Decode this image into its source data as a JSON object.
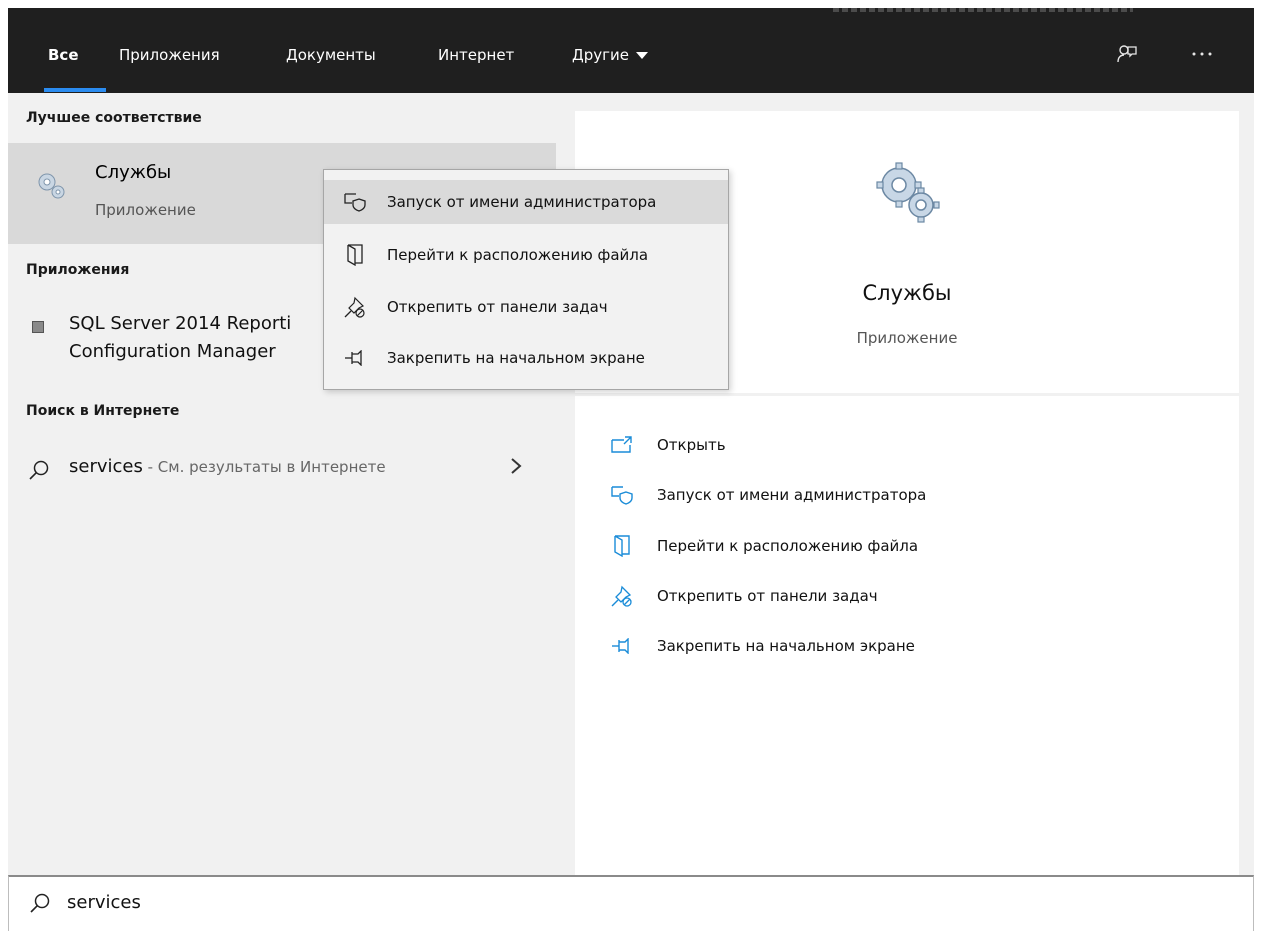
{
  "tabs": [
    {
      "label": "Все",
      "active": true
    },
    {
      "label": "Приложения"
    },
    {
      "label": "Документы"
    },
    {
      "label": "Интернет"
    },
    {
      "label": "Другие"
    }
  ],
  "topbar_icons": [
    "feedback-icon",
    "more-options-icon"
  ],
  "left": {
    "best_match_heading": "Лучшее соответствие",
    "best_match": {
      "title": "Службы",
      "subtitle": "Приложение",
      "icon": "services-gear-icon"
    },
    "apps_heading": "Приложения",
    "app_item": {
      "line1": "SQL Server 2014 Reporti",
      "line2": "Configuration Manager"
    },
    "web_heading": "Поиск в Интернете",
    "web_item": {
      "query": "services",
      "hint": " - См. результаты в Интернете"
    }
  },
  "context_menu": [
    {
      "label": "Запуск от имени администратора",
      "icon": "run-as-admin-icon"
    },
    {
      "label": "Перейти к расположению файла",
      "icon": "open-file-location-icon"
    },
    {
      "label": "Открепить от панели задач",
      "icon": "unpin-taskbar-icon"
    },
    {
      "label": "Закрепить на начальном экране",
      "icon": "pin-start-icon"
    }
  ],
  "preview": {
    "title": "Службы",
    "subtitle": "Приложение",
    "actions": [
      {
        "label": "Открыть",
        "icon": "open-icon"
      },
      {
        "label": "Запуск от имени администратора",
        "icon": "run-as-admin-icon"
      },
      {
        "label": "Перейти к расположению файла",
        "icon": "open-file-location-icon"
      },
      {
        "label": "Открепить от панели задач",
        "icon": "unpin-taskbar-icon"
      },
      {
        "label": "Закрепить на начальном экране",
        "icon": "pin-start-icon"
      }
    ]
  },
  "search": {
    "value": "services"
  },
  "colors": {
    "accent": "#2b8cf0",
    "topbar": "#1f1f1f",
    "icon_blue": "#1a8cd8"
  }
}
